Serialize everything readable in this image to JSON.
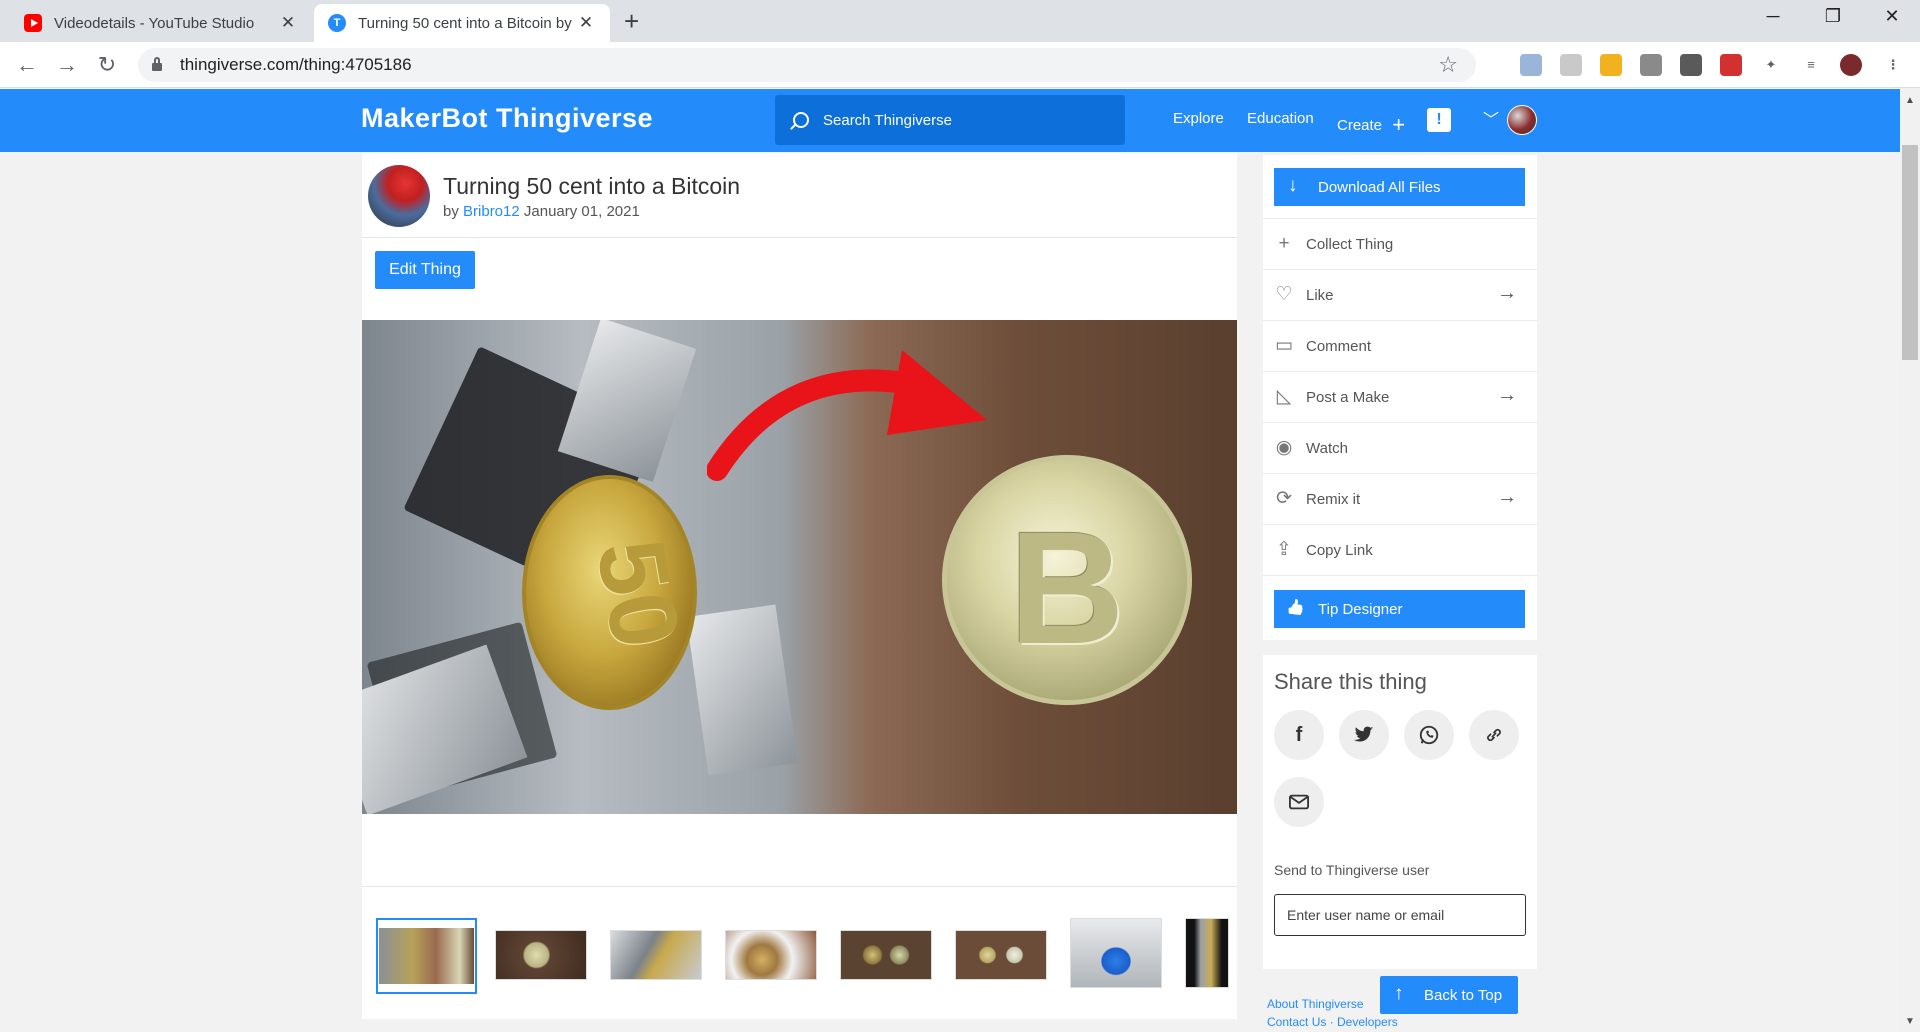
{
  "browser": {
    "tabs": [
      {
        "title": "Videodetails - YouTube Studio",
        "favicon": "youtube-icon"
      },
      {
        "title": "Turning 50 cent into a Bitcoin by",
        "favicon": "thingiverse-icon"
      }
    ],
    "url": "thingiverse.com/thing:4705186",
    "new_tab_glyph": "+",
    "close_glyph": "✕"
  },
  "site": {
    "logo": "MakerBot Thingiverse",
    "search_placeholder": "Search Thingiverse",
    "nav": {
      "explore": "Explore",
      "education": "Education",
      "create": "Create"
    },
    "notification_glyph": "!",
    "brand_color": "#248bfb"
  },
  "thing": {
    "title": "Turning 50 cent into a Bitcoin",
    "by_label": "by",
    "author": "Bribro12",
    "date": "January 01, 2021",
    "edit_label": "Edit Thing",
    "thumbnail_count": 8
  },
  "actions": {
    "download": "Download All Files",
    "items": [
      {
        "label": "Collect Thing",
        "icon": "plus-icon",
        "has_arrow": false
      },
      {
        "label": "Like",
        "icon": "heart-icon",
        "has_arrow": true
      },
      {
        "label": "Comment",
        "icon": "comment-icon",
        "has_arrow": false
      },
      {
        "label": "Post a Make",
        "icon": "make-icon",
        "has_arrow": true
      },
      {
        "label": "Watch",
        "icon": "eye-icon",
        "has_arrow": false
      },
      {
        "label": "Remix it",
        "icon": "remix-icon",
        "has_arrow": true
      },
      {
        "label": "Copy Link",
        "icon": "share-icon",
        "has_arrow": false
      }
    ],
    "tip": "Tip Designer"
  },
  "share": {
    "title": "Share this thing",
    "send_label": "Send to Thingiverse user",
    "send_placeholder": "Enter user name or email"
  },
  "footer": {
    "links_line1": "About Thingiverse",
    "links_line2": "Contact Us · Developers",
    "back_to_top": "Back to Top"
  }
}
